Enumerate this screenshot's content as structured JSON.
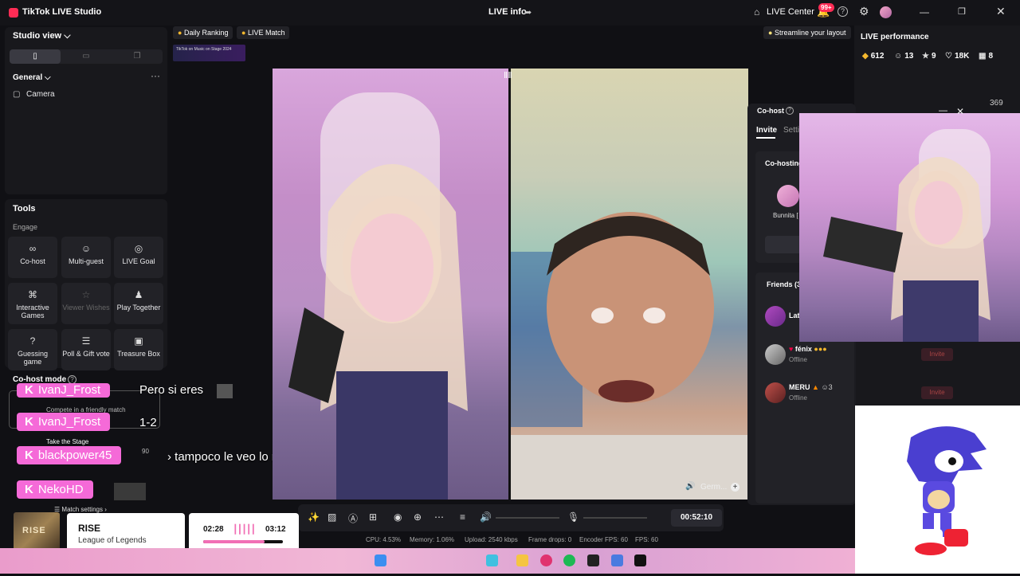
{
  "titlebar": {
    "app_title": "TikTok LIVE Studio",
    "live_info": "LIVE info",
    "live_center": "LIVE Center",
    "notifications_badge": "99+"
  },
  "studio": {
    "title": "Studio view",
    "general_label": "General",
    "more": "···",
    "camera_label": "Camera"
  },
  "tools": {
    "title": "Tools",
    "section": "Engage",
    "items": [
      {
        "label": "Co-host",
        "icon": "link-icon",
        "glyph": "∞"
      },
      {
        "label": "Multi-guest",
        "icon": "people-icon",
        "glyph": "☺"
      },
      {
        "label": "LIVE Goal",
        "icon": "target-icon",
        "glyph": "◎"
      },
      {
        "label": "Interactive Games",
        "icon": "gamepad-icon",
        "glyph": "⌘"
      },
      {
        "label": "Viewer Wishes",
        "icon": "wish-icon",
        "glyph": "☆"
      },
      {
        "label": "Play Together",
        "icon": "play-together-icon",
        "glyph": "♟"
      },
      {
        "label": "Guessing game",
        "icon": "question-icon",
        "glyph": "?"
      },
      {
        "label": "Poll & Gift vote",
        "icon": "poll-icon",
        "glyph": "☰"
      },
      {
        "label": "Treasure Box",
        "icon": "treasure-icon",
        "glyph": "▣"
      }
    ]
  },
  "cohost_mode": {
    "title": "Co-host mode",
    "compete_text": "Compete in a friendly match",
    "take_stage": "Take the Stage",
    "score": "90",
    "match_settings": "Match settings"
  },
  "chat": {
    "k_label": "K",
    "messages": [
      {
        "user": "IvanJ_Frost",
        "text": "Pero si eres"
      },
      {
        "user": "IvanJ_Frost",
        "text": "1-2"
      },
      {
        "user": "blackpower45",
        "text": "tampoco le veo lo malo"
      },
      {
        "user": "NekoHD",
        "text": ""
      }
    ]
  },
  "top_strip": {
    "daily_ranking": "Daily Ranking",
    "live_match": "LIVE Match",
    "streamline": "Streamline your layout",
    "banner_text": "TikTok on Music on Stage 2024"
  },
  "video": {
    "guest_label": "Germ..."
  },
  "controls": {
    "timer": "00:52:10",
    "stats": [
      {
        "label": "CPU: 4.53%"
      },
      {
        "label": "Memory: 1.06%"
      },
      {
        "label": "Upload: 2540 kbps"
      },
      {
        "label": "Frame drops: 0"
      },
      {
        "label": "Encoder FPS: 60"
      },
      {
        "label": "FPS: 60"
      }
    ]
  },
  "performance": {
    "title": "LIVE performance",
    "stats": [
      {
        "icon": "diamond-icon",
        "glyph": "◆",
        "value": "612",
        "color": "#f5b82e"
      },
      {
        "icon": "viewers-icon",
        "glyph": "☺",
        "value": "13",
        "color": "#ddd"
      },
      {
        "icon": "new-followers-icon",
        "glyph": "★",
        "value": "9",
        "color": "#ddd"
      },
      {
        "icon": "heart-icon",
        "glyph": "♡",
        "value": "18K",
        "color": "#ddd"
      },
      {
        "icon": "gift-icon",
        "glyph": "▦",
        "value": "8",
        "color": "#ddd"
      }
    ],
    "top_value": "369"
  },
  "cohost_panel": {
    "title": "Co-host",
    "tab_invite": "Invite",
    "tab_settings": "Setti",
    "cohosting_label": "Co-hosting",
    "bunnita_name": "Bunnita [",
    "friends_label": "Friends (3",
    "friends": [
      {
        "name": "Lat",
        "status": "",
        "count": ""
      },
      {
        "name": "fénix",
        "status": "Offline",
        "count": ""
      },
      {
        "name": "MERU",
        "status": "Offline",
        "count": "3"
      }
    ],
    "invite_label": "Invite"
  },
  "now_playing": {
    "album_text": "RISE",
    "title": "RISE",
    "artist": "League of Legends",
    "elapsed": "02:28",
    "total": "03:12",
    "progress": 0.77
  },
  "colors": {
    "accent": "#fe2c55",
    "pill": "#f56ad8"
  }
}
